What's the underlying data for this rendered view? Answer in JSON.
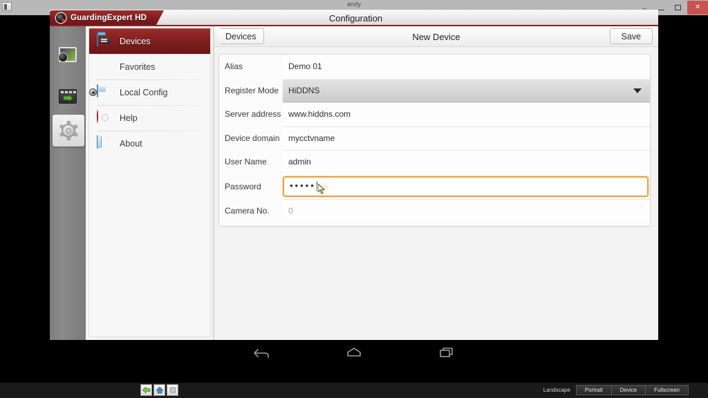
{
  "emulator": {
    "user_label": "andy",
    "corner_icon": "app-icon",
    "window_controls": [
      {
        "name": "resize-button",
        "glyph": "↔"
      },
      {
        "name": "minimize-button",
        "glyph": "—"
      },
      {
        "name": "restore-button",
        "glyph": "❐"
      },
      {
        "name": "close-button",
        "glyph": "✕"
      }
    ],
    "bottom_bar": {
      "left_buttons": [
        {
          "name": "back-button",
          "icon": "green-back-arrow-icon"
        },
        {
          "name": "home-button",
          "icon": "blue-home-icon"
        },
        {
          "name": "recents-button",
          "icon": "square-recents-icon"
        }
      ],
      "orientation_label": "Landscape",
      "tabs": [
        "Portrait",
        "Device",
        "Fullscreen"
      ]
    }
  },
  "window": {
    "app_tab_title": "GuardingExpert HD",
    "app_tab_icon": "camera-lens-icon",
    "title": "Configuration"
  },
  "rail": {
    "items": [
      {
        "name": "screenshot-tool",
        "icon": "screenshot-icon",
        "active": false
      },
      {
        "name": "record-tool",
        "icon": "screen-record-icon",
        "active": false
      },
      {
        "name": "settings-tool",
        "icon": "gear-icon",
        "active": true
      }
    ]
  },
  "sidebar": {
    "items": [
      {
        "label": "Devices",
        "icon": "folder-devices-icon",
        "selected": true
      },
      {
        "label": "Favorites",
        "icon": "star-icon",
        "selected": false
      },
      {
        "label": "Local Config",
        "icon": "local-config-icon",
        "selected": false
      },
      {
        "label": "Help",
        "icon": "lifebuoy-help-icon",
        "selected": false
      },
      {
        "label": "About",
        "icon": "info-book-icon",
        "selected": false
      }
    ]
  },
  "content": {
    "back_label": "Devices",
    "title": "New Device",
    "save_label": "Save",
    "form": {
      "rows": [
        {
          "label": "Alias",
          "value": "Demo 01",
          "type": "text"
        },
        {
          "label": "Register Mode",
          "value": "HiDDNS",
          "type": "select"
        },
        {
          "label": "Server address",
          "value": "www.hiddns.com",
          "type": "text"
        },
        {
          "label": "Device domain",
          "value": "mycctvname",
          "type": "text"
        },
        {
          "label": "User Name",
          "value": "admin",
          "type": "text"
        },
        {
          "label": "Password",
          "value": "•••••",
          "type": "password",
          "focused": true
        },
        {
          "label": "Camera No.",
          "value": "0",
          "type": "text",
          "dim": true
        }
      ]
    }
  },
  "navbar": {
    "buttons": [
      {
        "name": "android-back-button",
        "icon": "back-arrow-icon"
      },
      {
        "name": "android-home-button",
        "icon": "home-icon"
      },
      {
        "name": "android-recents-button",
        "icon": "recents-icon"
      }
    ]
  },
  "colors": {
    "brand_red": "#7e1f1f",
    "focus_orange": "#e8a33d",
    "close_red": "#c9534f",
    "app_bg": "#f2f1f1"
  }
}
